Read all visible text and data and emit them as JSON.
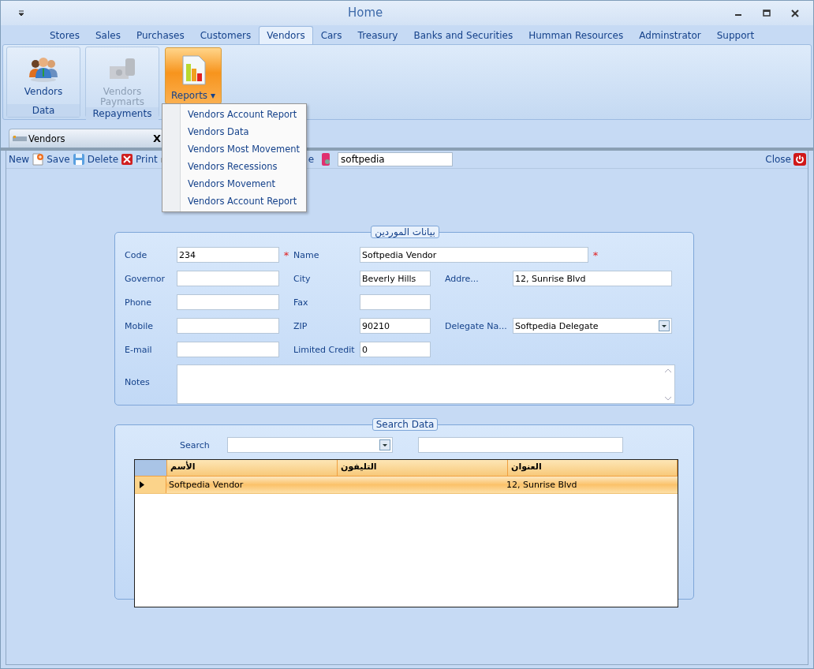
{
  "window": {
    "title": "Home"
  },
  "ribbon_tabs": [
    {
      "label": "Stores",
      "selected": false
    },
    {
      "label": "Sales",
      "selected": false
    },
    {
      "label": "Purchases",
      "selected": false
    },
    {
      "label": "Customers",
      "selected": false
    },
    {
      "label": "Vendors",
      "selected": true
    },
    {
      "label": "Cars",
      "selected": false
    },
    {
      "label": "Treasury",
      "selected": false
    },
    {
      "label": "Banks and Securities",
      "selected": false
    },
    {
      "label": "Humman Resources",
      "selected": false
    },
    {
      "label": "Adminstrator",
      "selected": false
    },
    {
      "label": "Support",
      "selected": false
    }
  ],
  "ribbon_groups": [
    {
      "button": "Vendors",
      "group": "Data",
      "disabled": false,
      "selected": false
    },
    {
      "button": "Vendors Paymarts",
      "group": "Repayments",
      "disabled": true,
      "selected": false
    },
    {
      "button": "Reports ▾",
      "disabled": false,
      "selected": true
    }
  ],
  "reports_menu": [
    "Vendors Account Report",
    "Vendors Data",
    "Vendors Most Movement",
    "Vendors Recessions",
    "Vendors Movement",
    "Vendors Account Report"
  ],
  "document_tab": {
    "label": "Vendors",
    "close": "X"
  },
  "toolbar": {
    "items": [
      "New",
      "Save",
      "Delete",
      "Print"
    ],
    "fragment": "e",
    "search_value": "softpedia",
    "close": "Close"
  },
  "form": {
    "title": "بيانات الموردين",
    "required_mark": "*",
    "fields": [
      {
        "label": "Code",
        "value": "234",
        "required": true
      },
      {
        "label": "Name",
        "value": "Softpedia Vendor",
        "required": true
      },
      {
        "label": "Governor",
        "required": false
      },
      {
        "label": "City",
        "value": "Beverly Hills",
        "required": false
      },
      {
        "label": "Addre...",
        "value": "12, Sunrise Blvd",
        "required": false
      },
      {
        "label": "Phone",
        "required": false
      },
      {
        "label": "Fax",
        "required": false
      },
      {
        "label": "Mobile",
        "required": false
      },
      {
        "label": "ZIP",
        "value": "90210",
        "required": false
      },
      {
        "label": "Delegate Na...",
        "value": "Softpedia Delegate",
        "required": false
      },
      {
        "label": "E-mail",
        "required": false
      },
      {
        "label": "Limited Credit",
        "value": "0",
        "required": false
      },
      {
        "label": "Notes",
        "required": false
      }
    ]
  },
  "search": {
    "title": "Search Data",
    "label": "Search",
    "columns": [
      "الأسم",
      "التليفون",
      "العنوان"
    ],
    "rows": [
      {
        "cells": [
          "Softpedia Vendor",
          "",
          "12, Sunrise Blvd"
        ],
        "selected": true
      }
    ]
  }
}
